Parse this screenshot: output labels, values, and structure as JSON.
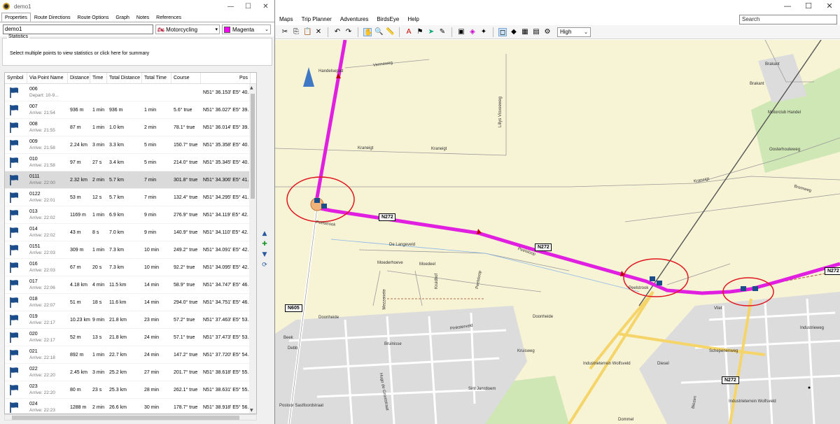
{
  "app": {
    "menu": [
      "Maps",
      "Trip Planner",
      "Adventures",
      "BirdsEye",
      "Help"
    ],
    "search_placeholder": "Search",
    "detail_level": "High",
    "window_controls": [
      "—",
      "☐",
      "✕"
    ]
  },
  "dialog": {
    "title": "demo1",
    "tabs": [
      "Properties",
      "Route Directions",
      "Route Options",
      "Graph",
      "Notes",
      "References"
    ],
    "route_name": "demo1",
    "profile": "Motorcycling",
    "color_name": "Magenta",
    "color_hex": "#ff00ff",
    "statistics_label": "Statistics",
    "statistics_text": "Select multiple points to view statistics or click here for summary",
    "columns": [
      "Symbol",
      "Via Point Name",
      "Distance",
      "Time",
      "Total Distance",
      "Total Time",
      "Course",
      "Pos"
    ],
    "rows": [
      {
        "name": "006",
        "sub": "Depart: 10-9...",
        "dist": "",
        "time": "",
        "tdist": "",
        "ttime": "",
        "course": "",
        "pos": "N51° 36.153' E5° 40."
      },
      {
        "name": "007",
        "sub": "Arrive: 21:54",
        "dist": "936 m",
        "time": "1 min",
        "tdist": "936 m",
        "ttime": "1 min",
        "course": "5.6° true",
        "pos": "N51° 36.027' E5° 39."
      },
      {
        "name": "008",
        "sub": "Arrive: 21:55",
        "dist": "87 m",
        "time": "1 min",
        "tdist": "1.0 km",
        "ttime": "2 min",
        "course": "78.1° true",
        "pos": "N51° 36.014' E5° 39."
      },
      {
        "name": "009",
        "sub": "Arrive: 21:58",
        "dist": "2.24 km",
        "time": "3 min",
        "tdist": "3.3 km",
        "ttime": "5 min",
        "course": "150.7° true",
        "pos": "N51° 35.358' E5° 40."
      },
      {
        "name": "010",
        "sub": "Arrive: 21:58",
        "dist": "97 m",
        "time": "27 s",
        "tdist": "3.4 km",
        "ttime": "5 min",
        "course": "214.0° true",
        "pos": "N51° 35.345' E5° 40."
      },
      {
        "name": "0111",
        "sub": "Arrive: 22:00",
        "dist": "2.32 km",
        "time": "2 min",
        "tdist": "5.7 km",
        "ttime": "7 min",
        "course": "301.8° true",
        "pos": "N51° 34.306' E5° 41.",
        "selected": true
      },
      {
        "name": "0122",
        "sub": "Arrive: 22:01",
        "dist": "53 m",
        "time": "12 s",
        "tdist": "5.7 km",
        "ttime": "7 min",
        "course": "132.4° true",
        "pos": "N51° 34.295' E5° 41."
      },
      {
        "name": "013",
        "sub": "Arrive: 22:02",
        "dist": "1169 m",
        "time": "1 min",
        "tdist": "6.9 km",
        "ttime": "9 min",
        "course": "276.9° true",
        "pos": "N51° 34.119' E5° 42."
      },
      {
        "name": "014",
        "sub": "Arrive: 22:02",
        "dist": "43 m",
        "time": "8 s",
        "tdist": "7.0 km",
        "ttime": "9 min",
        "course": "140.9° true",
        "pos": "N51° 34.110' E5° 42."
      },
      {
        "name": "0151",
        "sub": "Arrive: 22:03",
        "dist": "309 m",
        "time": "1 min",
        "tdist": "7.3 km",
        "ttime": "10 min",
        "course": "249.2° true",
        "pos": "N51° 34.091' E5° 42."
      },
      {
        "name": "016",
        "sub": "Arrive: 22:03",
        "dist": "67 m",
        "time": "20 s",
        "tdist": "7.3 km",
        "ttime": "10 min",
        "course": "92.2° true",
        "pos": "N51° 34.095' E5° 42."
      },
      {
        "name": "017",
        "sub": "Arrive: 22:06",
        "dist": "4.18 km",
        "time": "4 min",
        "tdist": "11.5 km",
        "ttime": "14 min",
        "course": "58.9° true",
        "pos": "N51° 34.747' E5° 46."
      },
      {
        "name": "018",
        "sub": "Arrive: 22:07",
        "dist": "51 m",
        "time": "18 s",
        "tdist": "11.6 km",
        "ttime": "14 min",
        "course": "294.0° true",
        "pos": "N51° 34.751' E5° 46."
      },
      {
        "name": "019",
        "sub": "Arrive: 22:17",
        "dist": "10.23 km",
        "time": "9 min",
        "tdist": "21.8 km",
        "ttime": "23 min",
        "course": "57.2° true",
        "pos": "N51° 37.463' E5° 53."
      },
      {
        "name": "020",
        "sub": "Arrive: 22:17",
        "dist": "52 m",
        "time": "13 s",
        "tdist": "21.8 km",
        "ttime": "24 min",
        "course": "57.1° true",
        "pos": "N51° 37.473' E5° 53."
      },
      {
        "name": "021",
        "sub": "Arrive: 22:18",
        "dist": "892 m",
        "time": "1 min",
        "tdist": "22.7 km",
        "ttime": "24 min",
        "course": "147.2° true",
        "pos": "N51° 37.720' E5° 54."
      },
      {
        "name": "022",
        "sub": "Arrive: 22:20",
        "dist": "2.45 km",
        "time": "3 min",
        "tdist": "25.2 km",
        "ttime": "27 min",
        "course": "201.7° true",
        "pos": "N51° 38.618' E5° 55."
      },
      {
        "name": "023",
        "sub": "Arrive: 22:20",
        "dist": "80 m",
        "time": "23 s",
        "tdist": "25.3 km",
        "ttime": "28 min",
        "course": "262.1° true",
        "pos": "N51° 38.631' E5° 55."
      },
      {
        "name": "024",
        "sub": "Arrive: 22:23",
        "dist": "1288 m",
        "time": "2 min",
        "tdist": "26.6 km",
        "ttime": "30 min",
        "course": "178.7° true",
        "pos": "N51° 38.918' E5° 56."
      }
    ]
  },
  "map": {
    "labels": [
      "Handelsepad",
      "Venneweg",
      "Kraneigt",
      "Kraneigt",
      "Lillys Visveeweg",
      "Brakant",
      "Brakant",
      "Motorclub Handel",
      "Oosterhouteweg",
      "Kraneigt",
      "Bremweg",
      "Peelstrook",
      "Peelstrook",
      "Peelsloop",
      "De Langeveld",
      "Moederhoeve",
      "Moedeel",
      "Kruidhof",
      "Peelsloop",
      "Mezzenete",
      "Doonheide",
      "Doonheide",
      "Pinksterveld",
      "Vliet",
      "Industrieweg",
      "Bruinisse",
      "Kruisweg",
      "Industrieterrein Wolfsveld",
      "Industrieterrein Wolfsveld",
      "Schepenenweg",
      "Dommel",
      "Beek",
      "Biezen",
      "Diesel",
      "Debb",
      "Postoor Sastfoordstraat",
      "Hugo de Grootstraat",
      "Sint Janstloem"
    ],
    "road_badges": [
      "N605",
      "N272",
      "N272",
      "N272",
      "N272"
    ],
    "route_color": "#e01fe0",
    "highlight_color": "#e0171f"
  }
}
